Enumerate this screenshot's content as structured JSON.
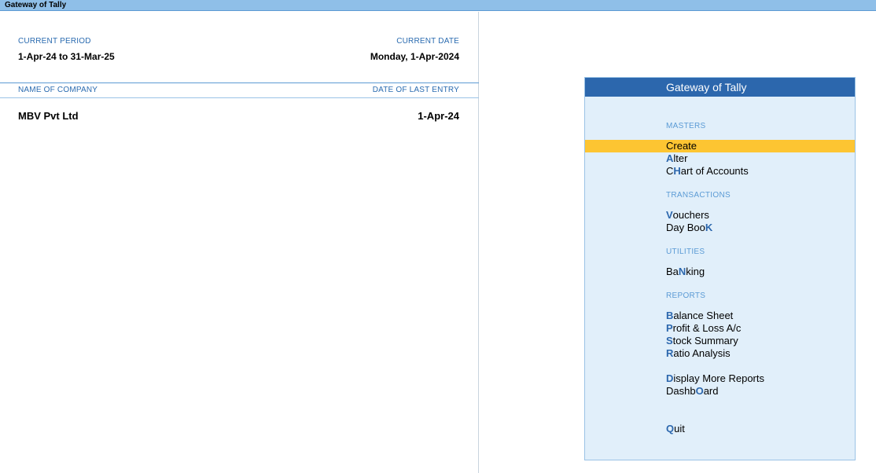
{
  "titlebar": {
    "title": "Gateway of Tally"
  },
  "period": {
    "current_period_label": "CURRENT PERIOD",
    "current_period_value": "1-Apr-24 to 31-Mar-25",
    "current_date_label": "CURRENT DATE",
    "current_date_value": "Monday, 1-Apr-2024"
  },
  "company_table": {
    "name_header": "NAME OF COMPANY",
    "last_entry_header": "DATE OF LAST ENTRY",
    "rows": [
      {
        "name": "MBV Pvt Ltd",
        "last_entry": "1-Apr-24"
      }
    ]
  },
  "gateway": {
    "title": "Gateway of Tally",
    "sections": [
      {
        "label": "MASTERS"
      },
      {
        "label": "TRANSACTIONS"
      },
      {
        "label": "UTILITIES"
      },
      {
        "label": "REPORTS"
      }
    ],
    "items": [
      {
        "full": "Create",
        "pre": "",
        "key": "C",
        "post": "reate",
        "hotkey_shown": false,
        "selected": true
      },
      {
        "full": "Alter",
        "pre": "",
        "key": "A",
        "post": "lter",
        "hotkey_shown": true
      },
      {
        "full": "CHart of Accounts",
        "pre": "C",
        "key": "H",
        "post": "art of Accounts",
        "hotkey_shown": true
      },
      {
        "full": "Vouchers",
        "pre": "",
        "key": "V",
        "post": "ouchers",
        "hotkey_shown": true
      },
      {
        "full": "Day BooK",
        "pre": "Day Boo",
        "key": "K",
        "post": "",
        "hotkey_shown": true
      },
      {
        "full": "BaNking",
        "pre": "Ba",
        "key": "N",
        "post": "king",
        "hotkey_shown": true
      },
      {
        "full": "Balance Sheet",
        "pre": "",
        "key": "B",
        "post": "alance Sheet",
        "hotkey_shown": true
      },
      {
        "full": "Profit & Loss A/c",
        "pre": "",
        "key": "P",
        "post": "rofit & Loss A/c",
        "hotkey_shown": true
      },
      {
        "full": "Stock Summary",
        "pre": "",
        "key": "S",
        "post": "tock Summary",
        "hotkey_shown": true
      },
      {
        "full": "Ratio Analysis",
        "pre": "",
        "key": "R",
        "post": "atio Analysis",
        "hotkey_shown": true
      },
      {
        "full": "Display More Reports",
        "pre": "",
        "key": "D",
        "post": "isplay More Reports",
        "hotkey_shown": true
      },
      {
        "full": "DashbOard",
        "pre": "Dashb",
        "key": "O",
        "post": "ard",
        "hotkey_shown": true
      },
      {
        "full": "Quit",
        "pre": "",
        "key": "Q",
        "post": "uit",
        "hotkey_shown": true
      }
    ]
  },
  "colors": {
    "titlebar_bg": "#8fbfe8",
    "label_blue": "#2a6bb0",
    "gateway_header_bg": "#2c67ad",
    "gateway_panel_bg": "#e1effa",
    "selection_bg": "#fdc532",
    "hotkey": "#2c67ad"
  }
}
